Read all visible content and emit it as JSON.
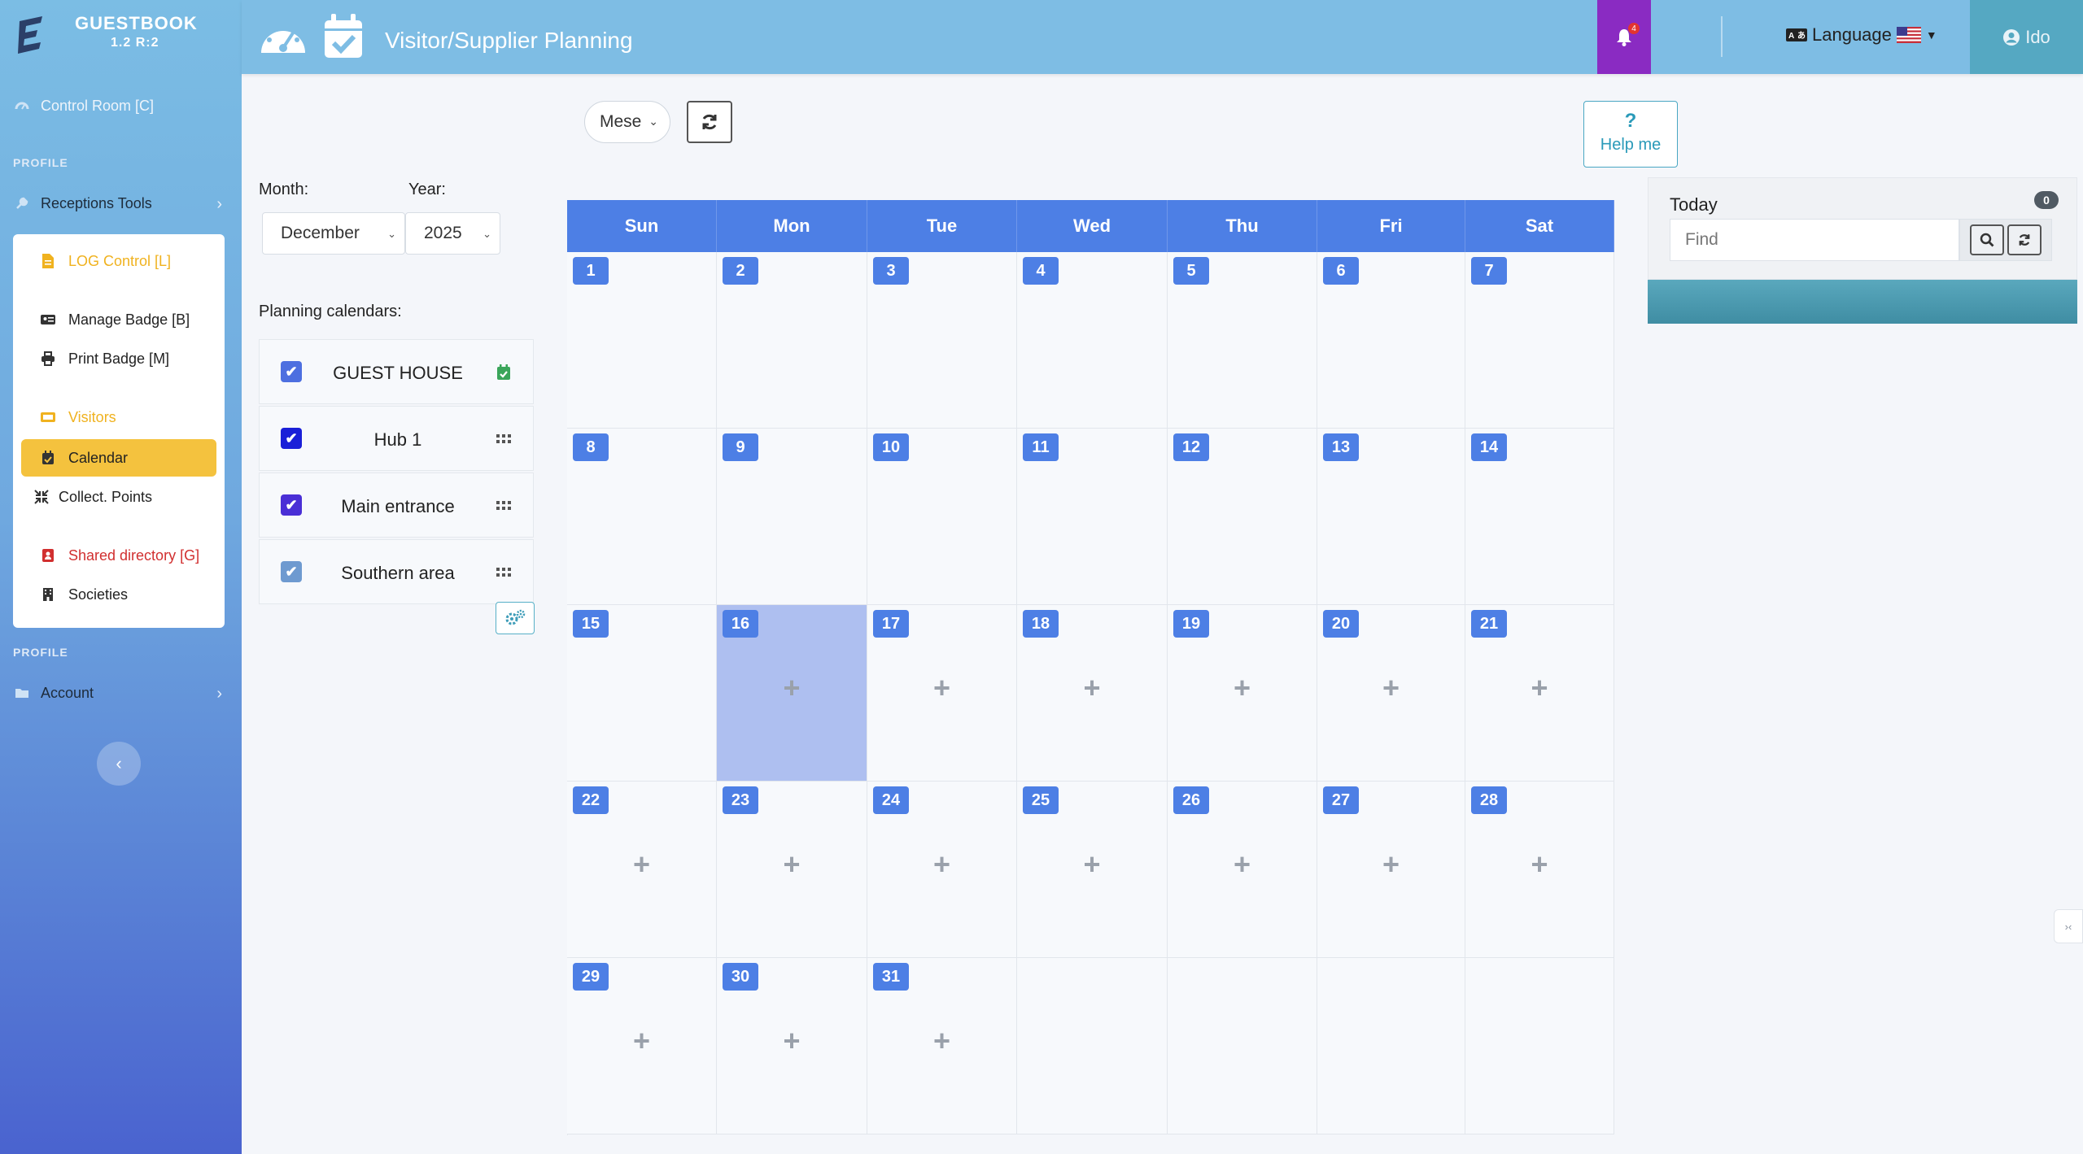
{
  "app": {
    "name": "GUESTBOOK",
    "version": "1.2 R:2"
  },
  "header": {
    "title": "Visitor/Supplier Planning",
    "notifications_count": "4",
    "language_label": "Language",
    "user_name": "Ido"
  },
  "sidebar": {
    "control_room": "Control Room [C]",
    "section1": "PROFILE",
    "reception_tools": "Receptions Tools",
    "section2": "PROFILE",
    "account": "Account",
    "submenu": [
      {
        "label": "LOG Control [L]",
        "icon": "file-icon",
        "style": "gold"
      },
      {
        "label": "Manage Badge [B]",
        "icon": "id-card-icon",
        "style": "normal"
      },
      {
        "label": "Print Badge [M]",
        "icon": "printer-icon",
        "style": "normal"
      },
      {
        "label": "Visitors",
        "icon": "ticket-icon",
        "style": "gold"
      },
      {
        "label": "Calendar",
        "icon": "calendar-icon",
        "style": "active"
      },
      {
        "label": "Collect. Points",
        "icon": "compress-icon",
        "style": "normal"
      },
      {
        "label": "Shared directory [G]",
        "icon": "address-book-icon",
        "style": "red"
      },
      {
        "label": "Societies",
        "icon": "building-icon",
        "style": "normal"
      }
    ]
  },
  "toolbar": {
    "view_mode": "Mese",
    "help_icon": "?",
    "help_label": "Help me"
  },
  "filters": {
    "month_label": "Month:",
    "month_value": "December",
    "year_label": "Year:",
    "year_value": "2025",
    "planning_label": "Planning calendars:",
    "calendars": [
      {
        "name": "GUEST HOUSE",
        "color": "#4d6fe0",
        "icon": "calendar-check-icon"
      },
      {
        "name": "Hub 1",
        "color": "#1a1fd8",
        "icon": "grid-icon"
      },
      {
        "name": "Main entrance",
        "color": "#4a2fd6",
        "icon": "grid-icon"
      },
      {
        "name": "Southern area",
        "color": "#6e9ad0",
        "icon": "grid-icon"
      }
    ]
  },
  "calendar": {
    "weekdays": [
      "Sun",
      "Mon",
      "Tue",
      "Wed",
      "Thu",
      "Fri",
      "Sat"
    ],
    "weeks": [
      [
        1,
        2,
        3,
        4,
        5,
        6,
        7
      ],
      [
        8,
        9,
        10,
        11,
        12,
        13,
        14
      ],
      [
        15,
        16,
        17,
        18,
        19,
        20,
        21
      ],
      [
        22,
        23,
        24,
        25,
        26,
        27,
        28
      ],
      [
        29,
        30,
        31,
        null,
        null,
        null,
        null
      ]
    ],
    "today": 16,
    "first_addable_day": 16,
    "add_symbol": "+"
  },
  "right_panel": {
    "title": "Today",
    "count": "0",
    "search_placeholder": "Find"
  },
  "colors": {
    "accent": "#4d7fe5",
    "today_cell": "#aebff0",
    "active_menu": "#f4c23e",
    "notify": "#8a2bc2",
    "user": "#55a8c2"
  }
}
